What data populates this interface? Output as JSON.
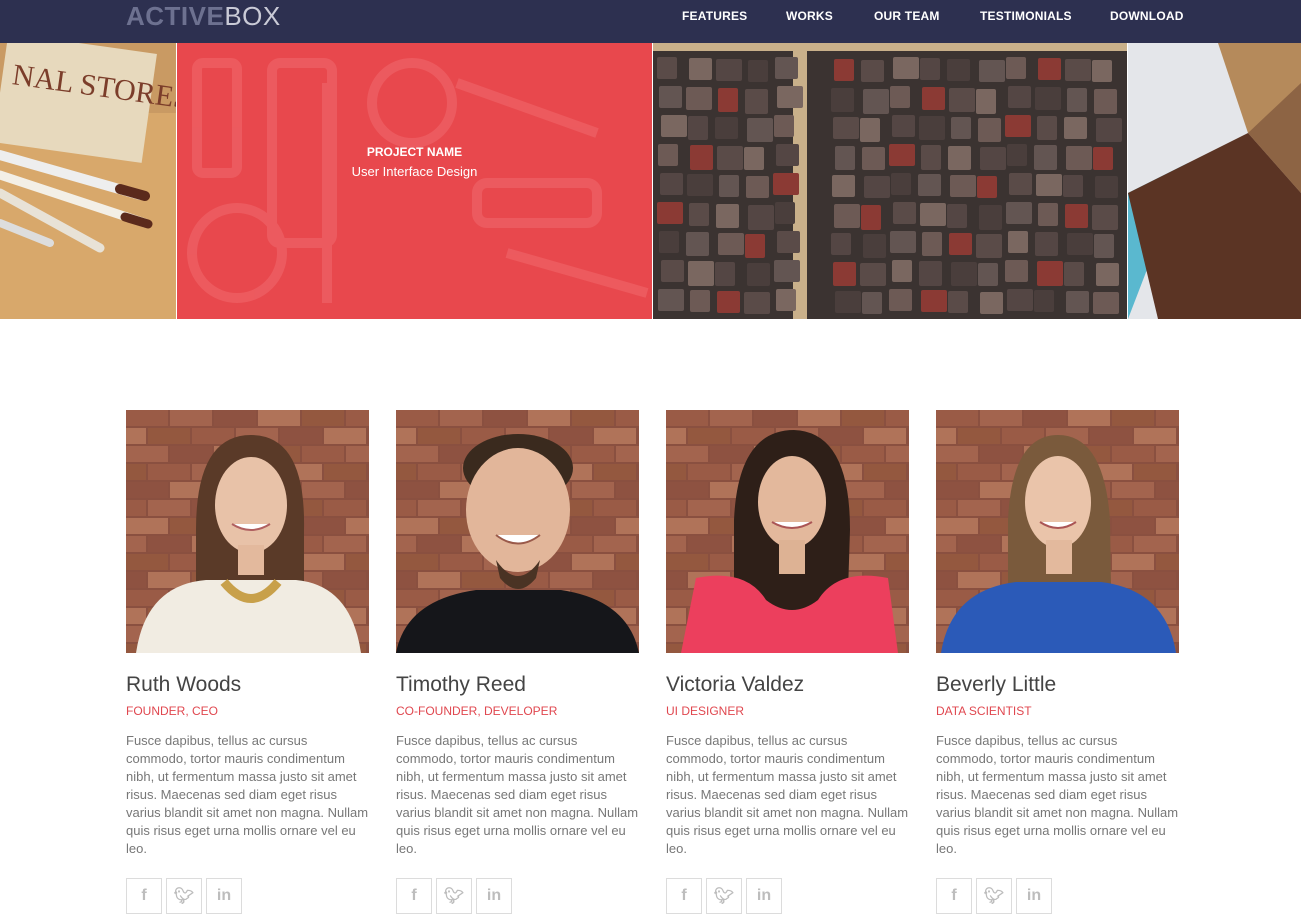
{
  "logo": {
    "bold": "ACTIVE",
    "light": "BOX"
  },
  "nav": [
    {
      "label": "FEATURES"
    },
    {
      "label": "WORKS"
    },
    {
      "label": "OUR TEAM"
    },
    {
      "label": "TESTIMONIALS"
    },
    {
      "label": "DOWNLOAD"
    }
  ],
  "portfolio": {
    "hover_title": "PROJECT NAME",
    "hover_subtitle": "User Interface Design",
    "accent": "#e8484d"
  },
  "team": [
    {
      "name": "Ruth Woods",
      "role": "FOUNDER, CEO",
      "bio": "Fusce dapibus, tellus ac cursus commodo, tortor mauris condimentum nibh, ut fermentum massa justo sit amet risus. Maecenas sed diam eget risus varius blandit sit amet non magna. Nullam quis risus eget urna mollis ornare vel eu leo.",
      "socials": [
        "f",
        "t",
        "in"
      ]
    },
    {
      "name": "Timothy Reed",
      "role": "CO-FOUNDER, DEVELOPER",
      "bio": "Fusce dapibus, tellus ac cursus commodo, tortor mauris condimentum nibh, ut fermentum massa justo sit amet risus. Maecenas sed diam eget risus varius blandit sit amet non magna. Nullam quis risus eget urna mollis ornare vel eu leo.",
      "socials": [
        "f",
        "t",
        "in"
      ]
    },
    {
      "name": "Victoria Valdez",
      "role": "UI DESIGNER",
      "bio": "Fusce dapibus, tellus ac cursus commodo, tortor mauris condimentum nibh, ut fermentum massa justo sit amet risus. Maecenas sed diam eget risus varius blandit sit amet non magna. Nullam quis risus eget urna mollis ornare vel eu leo.",
      "socials": [
        "f",
        "t",
        "in"
      ]
    },
    {
      "name": "Beverly Little",
      "role": "DATA SCIENTIST",
      "bio": "Fusce dapibus, tellus ac cursus commodo, tortor mauris condimentum nibh, ut fermentum massa justo sit amet risus. Maecenas sed diam eget risus varius blandit sit amet non magna. Nullam quis risus eget urna mollis ornare vel eu leo.",
      "socials": [
        "f",
        "t",
        "in"
      ]
    }
  ],
  "social_icon_names": [
    "facebook-icon",
    "twitter-icon",
    "linkedin-icon"
  ],
  "colors": {
    "navbar": "#2d3050",
    "role": "#e0474f"
  }
}
